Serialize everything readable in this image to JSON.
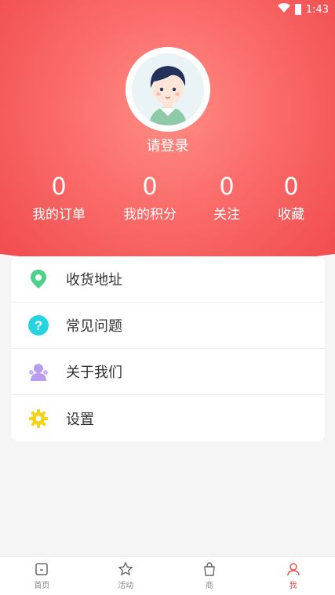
{
  "status_bar": {
    "time": "1:43"
  },
  "profile": {
    "login_label": "请登录"
  },
  "stats": [
    {
      "value": "0",
      "label": "我的订单"
    },
    {
      "value": "0",
      "label": "我的积分"
    },
    {
      "value": "0",
      "label": "关注"
    },
    {
      "value": "0",
      "label": "收藏"
    }
  ],
  "menu": [
    {
      "label": "收货地址",
      "icon": "location-pin-icon",
      "color": "#4cd08a"
    },
    {
      "label": "常见问题",
      "icon": "question-icon",
      "color": "#26d3e0"
    },
    {
      "label": "关于我们",
      "icon": "group-icon",
      "color": "#b79cf0"
    },
    {
      "label": "设置",
      "icon": "gear-icon",
      "color": "#f5d21a"
    }
  ],
  "tabbar": [
    {
      "label": "首页",
      "icon": "home-icon"
    },
    {
      "label": "活动",
      "icon": "star-icon"
    },
    {
      "label": "商",
      "icon": "bag-icon"
    },
    {
      "label": "我",
      "icon": "user-icon"
    }
  ],
  "colors": {
    "hero": "#f65a5a",
    "accent": "#ff6b6b"
  }
}
